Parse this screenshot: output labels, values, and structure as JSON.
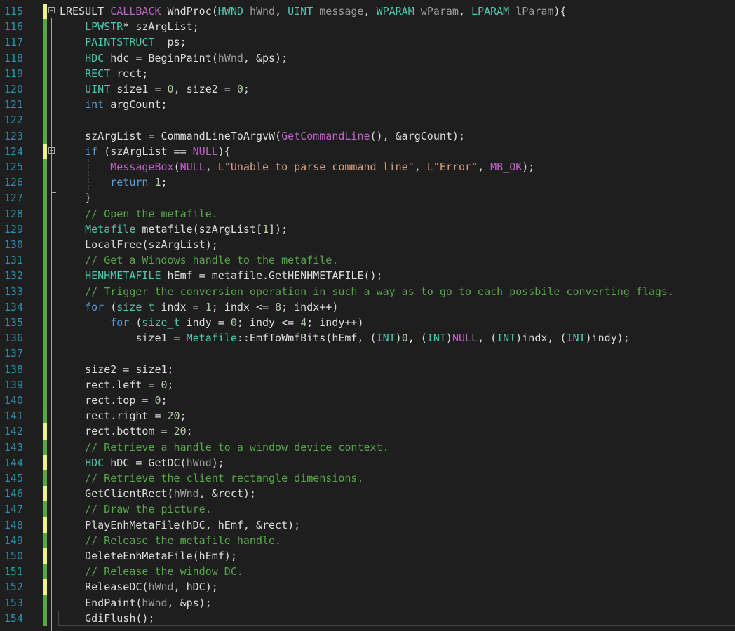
{
  "editor": {
    "language": "C++",
    "theme_colors": {
      "background": "#1e1e1e",
      "line_number": "#2b91af",
      "keyword": "#569cd6",
      "type": "#4ec9b0",
      "macro": "#bd63c5",
      "string": "#d69d85",
      "number": "#b5cea8",
      "comment": "#57a64a",
      "parameter": "#9a9a9a",
      "text": "#dcdcdc",
      "saved_change": "#57a64a",
      "unsaved_change": "#efef91"
    },
    "current_line": 154,
    "lines": [
      {
        "n": "115",
        "change": "unsaved",
        "fold": true,
        "tokens": [
          [
            "txt",
            "LRESULT "
          ],
          [
            "macro",
            "CALLBACK "
          ],
          [
            "txt",
            "WndProc("
          ],
          [
            "type",
            "HWND "
          ],
          [
            "param",
            "hWnd"
          ],
          [
            "txt",
            ", "
          ],
          [
            "type",
            "UINT "
          ],
          [
            "param",
            "message"
          ],
          [
            "txt",
            ", "
          ],
          [
            "type",
            "WPARAM "
          ],
          [
            "param",
            "wParam"
          ],
          [
            "txt",
            ", "
          ],
          [
            "type",
            "LPARAM "
          ],
          [
            "param",
            "lParam"
          ],
          [
            "txt",
            "){"
          ]
        ]
      },
      {
        "n": "116",
        "change": "saved",
        "tokens": [
          [
            "txt",
            "    "
          ],
          [
            "type",
            "LPWSTR"
          ],
          [
            "txt",
            "* szArgList;"
          ]
        ]
      },
      {
        "n": "117",
        "change": "saved",
        "tokens": [
          [
            "txt",
            "    "
          ],
          [
            "type",
            "PAINTSTRUCT"
          ],
          [
            "txt",
            "  ps;"
          ]
        ]
      },
      {
        "n": "118",
        "change": "saved",
        "tokens": [
          [
            "txt",
            "    "
          ],
          [
            "type",
            "HDC"
          ],
          [
            "txt",
            " hdc = BeginPaint("
          ],
          [
            "param",
            "hWnd"
          ],
          [
            "txt",
            ", &ps);"
          ]
        ]
      },
      {
        "n": "119",
        "change": "saved",
        "tokens": [
          [
            "txt",
            "    "
          ],
          [
            "type",
            "RECT"
          ],
          [
            "txt",
            " rect;"
          ]
        ]
      },
      {
        "n": "120",
        "change": "saved",
        "tokens": [
          [
            "txt",
            "    "
          ],
          [
            "type",
            "UINT"
          ],
          [
            "txt",
            " size1 = "
          ],
          [
            "num",
            "0"
          ],
          [
            "txt",
            ", size2 = "
          ],
          [
            "num",
            "0"
          ],
          [
            "txt",
            ";"
          ]
        ]
      },
      {
        "n": "121",
        "change": "saved",
        "tokens": [
          [
            "txt",
            "    "
          ],
          [
            "kw",
            "int"
          ],
          [
            "txt",
            " argCount;"
          ]
        ]
      },
      {
        "n": "122",
        "change": "saved",
        "tokens": []
      },
      {
        "n": "123",
        "change": "saved",
        "tokens": [
          [
            "txt",
            "    szArgList = CommandLineToArgvW("
          ],
          [
            "macro",
            "GetCommandLine"
          ],
          [
            "txt",
            "(), &argCount);"
          ]
        ]
      },
      {
        "n": "124",
        "change": "unsaved",
        "fold": true,
        "tokens": [
          [
            "txt",
            "    "
          ],
          [
            "kw",
            "if"
          ],
          [
            "txt",
            " (szArgList == "
          ],
          [
            "macro",
            "NULL"
          ],
          [
            "txt",
            "){"
          ]
        ]
      },
      {
        "n": "125",
        "change": "saved",
        "tokens": [
          [
            "txt",
            "        "
          ],
          [
            "macro",
            "MessageBox"
          ],
          [
            "txt",
            "("
          ],
          [
            "macro",
            "NULL"
          ],
          [
            "txt",
            ", "
          ],
          [
            "str",
            "L\"Unable to parse command line\""
          ],
          [
            "txt",
            ", "
          ],
          [
            "str",
            "L\"Error\""
          ],
          [
            "txt",
            ", "
          ],
          [
            "macro",
            "MB_OK"
          ],
          [
            "txt",
            ");"
          ]
        ]
      },
      {
        "n": "126",
        "change": "saved",
        "tokens": [
          [
            "txt",
            "        "
          ],
          [
            "kw",
            "return"
          ],
          [
            "txt",
            " "
          ],
          [
            "num",
            "1"
          ],
          [
            "txt",
            ";"
          ]
        ]
      },
      {
        "n": "127",
        "change": "saved",
        "tokens": [
          [
            "txt",
            "    }"
          ]
        ]
      },
      {
        "n": "128",
        "change": "saved",
        "tokens": [
          [
            "txt",
            "    "
          ],
          [
            "com",
            "// Open the metafile."
          ]
        ]
      },
      {
        "n": "129",
        "change": "saved",
        "tokens": [
          [
            "txt",
            "    "
          ],
          [
            "type",
            "Metafile"
          ],
          [
            "txt",
            " metafile(szArgList["
          ],
          [
            "num",
            "1"
          ],
          [
            "txt",
            "]);"
          ]
        ]
      },
      {
        "n": "130",
        "change": "saved",
        "tokens": [
          [
            "txt",
            "    LocalFree(szArgList);"
          ]
        ]
      },
      {
        "n": "131",
        "change": "saved",
        "tokens": [
          [
            "txt",
            "    "
          ],
          [
            "com",
            "// Get a Windows handle to the metafile."
          ]
        ]
      },
      {
        "n": "132",
        "change": "saved",
        "tokens": [
          [
            "txt",
            "    "
          ],
          [
            "type",
            "HENHMETAFILE"
          ],
          [
            "txt",
            " hEmf = metafile.GetHENHMETAFILE();"
          ]
        ]
      },
      {
        "n": "133",
        "change": "saved",
        "tokens": [
          [
            "txt",
            "    "
          ],
          [
            "com",
            "// Trigger the conversion operation in such a way as to go to each possbile converting flags."
          ]
        ]
      },
      {
        "n": "134",
        "change": "saved",
        "tokens": [
          [
            "txt",
            "    "
          ],
          [
            "kw",
            "for"
          ],
          [
            "txt",
            " ("
          ],
          [
            "type",
            "size_t"
          ],
          [
            "txt",
            " indx = "
          ],
          [
            "num",
            "1"
          ],
          [
            "txt",
            "; indx <= "
          ],
          [
            "num",
            "8"
          ],
          [
            "txt",
            "; indx++)"
          ]
        ]
      },
      {
        "n": "135",
        "change": "saved",
        "tokens": [
          [
            "txt",
            "        "
          ],
          [
            "kw",
            "for"
          ],
          [
            "txt",
            " ("
          ],
          [
            "type",
            "size_t"
          ],
          [
            "txt",
            " indy = "
          ],
          [
            "num",
            "0"
          ],
          [
            "txt",
            "; indy <= "
          ],
          [
            "num",
            "4"
          ],
          [
            "txt",
            "; indy++)"
          ]
        ]
      },
      {
        "n": "136",
        "change": "saved",
        "tokens": [
          [
            "txt",
            "            size1 = "
          ],
          [
            "type",
            "Metafile"
          ],
          [
            "txt",
            "::EmfToWmfBits(hEmf, ("
          ],
          [
            "type",
            "INT"
          ],
          [
            "txt",
            ")"
          ],
          [
            "num",
            "0"
          ],
          [
            "txt",
            ", ("
          ],
          [
            "type",
            "INT"
          ],
          [
            "txt",
            ")"
          ],
          [
            "macro",
            "NULL"
          ],
          [
            "txt",
            ", ("
          ],
          [
            "type",
            "INT"
          ],
          [
            "txt",
            ")indx, ("
          ],
          [
            "type",
            "INT"
          ],
          [
            "txt",
            ")indy);"
          ]
        ]
      },
      {
        "n": "137",
        "change": "saved",
        "tokens": []
      },
      {
        "n": "138",
        "change": "saved",
        "tokens": [
          [
            "txt",
            "    size2 = size1;"
          ]
        ]
      },
      {
        "n": "139",
        "change": "saved",
        "tokens": [
          [
            "txt",
            "    rect.left = "
          ],
          [
            "num",
            "0"
          ],
          [
            "txt",
            ";"
          ]
        ]
      },
      {
        "n": "140",
        "change": "saved",
        "tokens": [
          [
            "txt",
            "    rect.top = "
          ],
          [
            "num",
            "0"
          ],
          [
            "txt",
            ";"
          ]
        ]
      },
      {
        "n": "141",
        "change": "saved",
        "tokens": [
          [
            "txt",
            "    rect.right = "
          ],
          [
            "num",
            "20"
          ],
          [
            "txt",
            ";"
          ]
        ]
      },
      {
        "n": "142",
        "change": "unsaved",
        "tokens": [
          [
            "txt",
            "    rect.bottom = "
          ],
          [
            "num",
            "20"
          ],
          [
            "txt",
            ";"
          ]
        ]
      },
      {
        "n": "143",
        "change": "saved",
        "tokens": [
          [
            "txt",
            "    "
          ],
          [
            "com",
            "// Retrieve a handle to a window device context."
          ]
        ]
      },
      {
        "n": "144",
        "change": "unsaved",
        "tokens": [
          [
            "txt",
            "    "
          ],
          [
            "type",
            "HDC"
          ],
          [
            "txt",
            " hDC = GetDC("
          ],
          [
            "param",
            "hWnd"
          ],
          [
            "txt",
            ");"
          ]
        ]
      },
      {
        "n": "145",
        "change": "saved",
        "tokens": [
          [
            "txt",
            "    "
          ],
          [
            "com",
            "// Retrieve the client rectangle dimensions."
          ]
        ]
      },
      {
        "n": "146",
        "change": "unsaved",
        "tokens": [
          [
            "txt",
            "    GetClientRect("
          ],
          [
            "param",
            "hWnd"
          ],
          [
            "txt",
            ", &rect);"
          ]
        ]
      },
      {
        "n": "147",
        "change": "saved",
        "tokens": [
          [
            "txt",
            "    "
          ],
          [
            "com",
            "// Draw the picture."
          ]
        ]
      },
      {
        "n": "148",
        "change": "unsaved",
        "tokens": [
          [
            "txt",
            "    PlayEnhMetaFile(hDC, hEmf, &rect);"
          ]
        ]
      },
      {
        "n": "149",
        "change": "saved",
        "tokens": [
          [
            "txt",
            "    "
          ],
          [
            "com",
            "// Release the metafile handle."
          ]
        ]
      },
      {
        "n": "150",
        "change": "unsaved",
        "tokens": [
          [
            "txt",
            "    DeleteEnhMetaFile(hEmf);"
          ]
        ]
      },
      {
        "n": "151",
        "change": "saved",
        "tokens": [
          [
            "txt",
            "    "
          ],
          [
            "com",
            "// Release the window DC."
          ]
        ]
      },
      {
        "n": "152",
        "change": "unsaved",
        "tokens": [
          [
            "txt",
            "    ReleaseDC("
          ],
          [
            "param",
            "hWnd"
          ],
          [
            "txt",
            ", hDC);"
          ]
        ]
      },
      {
        "n": "153",
        "change": "saved",
        "tokens": [
          [
            "txt",
            "    EndPaint("
          ],
          [
            "param",
            "hWnd"
          ],
          [
            "txt",
            ", &ps);"
          ]
        ]
      },
      {
        "n": "154",
        "change": "saved",
        "tokens": [
          [
            "txt",
            "    GdiFlush();"
          ]
        ]
      }
    ]
  }
}
